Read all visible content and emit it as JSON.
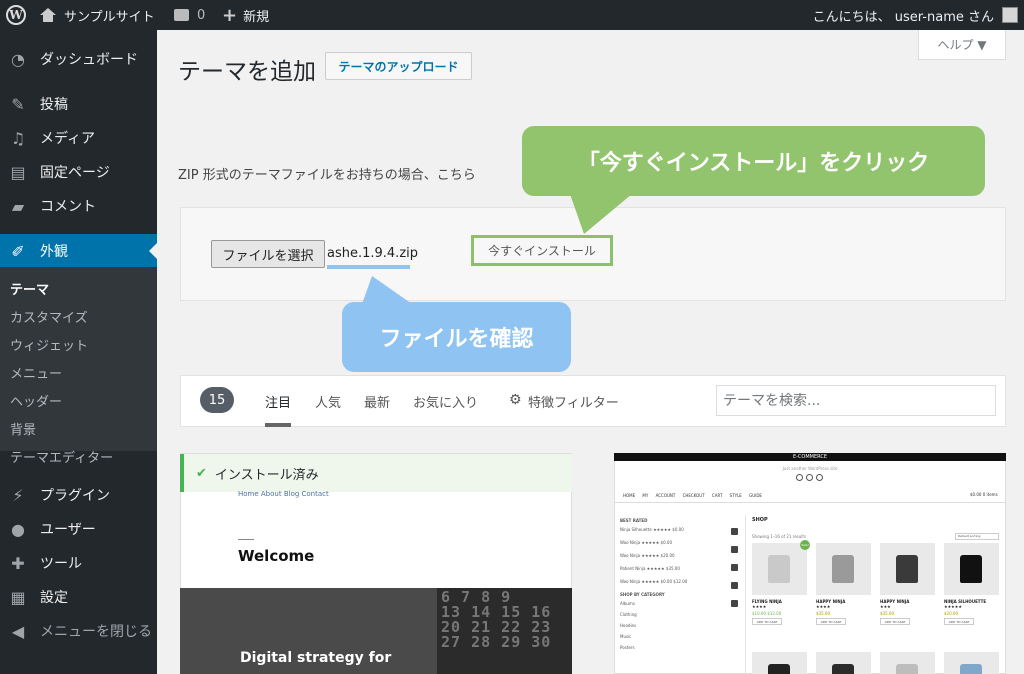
{
  "adminbar": {
    "site_name": "サンプルサイト",
    "comments_count": "0",
    "new_label": "新規",
    "greeting": "こんにちは、 user-name さん"
  },
  "sidebar": {
    "items": [
      {
        "label": "ダッシュボード",
        "icon": "dashboard-icon"
      },
      {
        "label": "投稿",
        "icon": "pin-icon"
      },
      {
        "label": "メディア",
        "icon": "media-icon"
      },
      {
        "label": "固定ページ",
        "icon": "pages-icon"
      },
      {
        "label": "コメント",
        "icon": "comment-icon"
      },
      {
        "label": "外観",
        "icon": "appearance-icon",
        "active": true
      },
      {
        "label": "プラグイン",
        "icon": "plugin-icon"
      },
      {
        "label": "ユーザー",
        "icon": "users-icon"
      },
      {
        "label": "ツール",
        "icon": "tools-icon"
      },
      {
        "label": "設定",
        "icon": "settings-icon"
      },
      {
        "label": "メニューを閉じる",
        "icon": "collapse-icon"
      }
    ],
    "submenu": [
      {
        "label": "テーマ",
        "current": true
      },
      {
        "label": "カスタマイズ"
      },
      {
        "label": "ウィジェット"
      },
      {
        "label": "メニュー"
      },
      {
        "label": "ヘッダー"
      },
      {
        "label": "背景"
      },
      {
        "label": "テーマエディター"
      }
    ]
  },
  "main": {
    "title": "テーマを追加",
    "upload_button": "テーマのアップロード",
    "help_label": "ヘルプ ▼",
    "instruction": "ZIP 形式のテーマファイルをお持ちの場合、こちら",
    "file_button": "ファイルを選択",
    "file_name": "ashe.1.9.4.zip",
    "install_button": "今すぐインストール"
  },
  "annotations": {
    "install_callout": "「今すぐインストール」をクリック",
    "file_callout": "ファイルを確認",
    "colors": {
      "green": "#92c46e",
      "blue": "#8fc4f2"
    }
  },
  "filter": {
    "count": "15",
    "tabs": [
      "注目",
      "人気",
      "最新",
      "お気に入り"
    ],
    "feature_filter": "特徴フィルター",
    "search_placeholder": "テーマを検索..."
  },
  "theme1": {
    "installed_label": "インストール済み",
    "nav_text": "Home About Blog Contact",
    "welcome": "Welcome",
    "hero_text": "Digital strategy for",
    "calendar": "6 7 8 9\n13 14 15 16\n20 21 22 23\n27 28 29 30"
  },
  "theme2": {
    "header": "E-COMMERCE",
    "tagline": "Just another WordPress site",
    "nav": "HOME MY ACCOUNT CHECKOUT CART STYLE GUIDE",
    "cart": "$0.00 0 items",
    "sidebar_title": "BEST RATED",
    "best_rated": [
      "Ninja Silhouette ★★★★★ $0.00",
      "Woo Ninja ★★★★★ $0.00",
      "Woo Ninja ★★★★★ $20.00",
      "Patient Ninja ★★★★★ $35.00",
      "Woo Ninja ★★★★★ $0.00 $12.00"
    ],
    "category_title": "SHOP BY CATEGORY",
    "categories": [
      "Albums",
      "Clothing",
      "Hoodies",
      "Music",
      "Posters"
    ],
    "shop_title": "SHOP",
    "showing": "Showing 1–16 of 21 results",
    "sort": "Default sorting",
    "products": [
      {
        "name": "FLYING NINJA",
        "stars": "★★★★",
        "price": "$10.00 $12.00",
        "button": "ADD TO CART",
        "sale": "Sale!"
      },
      {
        "name": "HAPPY NINJA",
        "stars": "★★★★",
        "price": "$35.00",
        "button": "ADD TO CART"
      },
      {
        "name": "HAPPY NINJA",
        "stars": "★★★",
        "price": "$35.00",
        "button": "ADD TO CART"
      },
      {
        "name": "NINJA SILHOUETTE",
        "stars": "★★★★★",
        "price": "$20.00",
        "button": "ADD TO CART"
      }
    ]
  }
}
